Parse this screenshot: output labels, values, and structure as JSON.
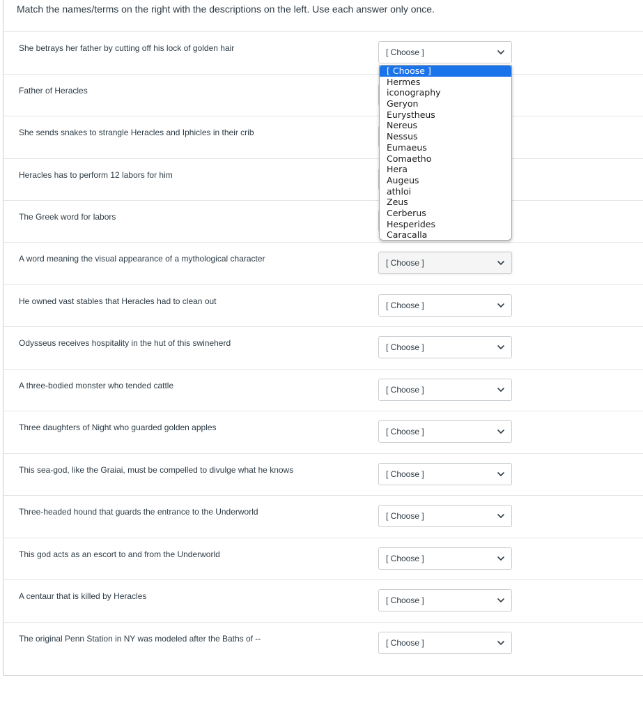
{
  "instructions": "Match the names/terms on the right with the descriptions on the left.  Use each answer only once.",
  "questions": [
    {
      "description": "She betrays her father by cutting off his lock of golden hair",
      "selected": "[ Choose ]"
    },
    {
      "description": "Father of Heracles",
      "selected": "[ Choose ]"
    },
    {
      "description": "She sends snakes to strangle Heracles and Iphicles in their crib",
      "selected": "[ Choose ]"
    },
    {
      "description": "Heracles has to perform 12 labors for him",
      "selected": "[ Choose ]"
    },
    {
      "description": "The Greek word for labors",
      "selected": "[ Choose ]"
    },
    {
      "description": "A word meaning the visual appearance of a mythological character",
      "selected": "[ Choose ]"
    },
    {
      "description": "He owned vast stables that Heracles had to clean out",
      "selected": "[ Choose ]"
    },
    {
      "description": "Odysseus receives hospitality in the hut of this swineherd",
      "selected": "[ Choose ]"
    },
    {
      "description": "A three-bodied monster who tended cattle",
      "selected": "[ Choose ]"
    },
    {
      "description": "Three daughters of Night who guarded golden apples",
      "selected": "[ Choose ]"
    },
    {
      "description": "This sea-god, like the Graiai, must be compelled to divulge what he knows",
      "selected": "[ Choose ]"
    },
    {
      "description": "Three-headed hound that guards the entrance to the Underworld",
      "selected": "[ Choose ]"
    },
    {
      "description": "This god acts as an escort to and from the Underworld",
      "selected": "[ Choose ]"
    },
    {
      "description": "A centaur that is killed by Heracles",
      "selected": "[ Choose ]"
    },
    {
      "description": "The original Penn Station in NY was modeled after the Baths of --",
      "selected": "[ Choose ]"
    }
  ],
  "dropdown_options": [
    "[ Choose ]",
    "Hermes",
    "iconography",
    "Geryon",
    "Eurystheus",
    "Nereus",
    "Nessus",
    "Eumaeus",
    "Comaetho",
    "Hera",
    "Augeus",
    "athloi",
    "Zeus",
    "Cerberus",
    "Hesperides",
    "Caracalla"
  ],
  "colors": {
    "selected_option_bg": "#1a73e8",
    "text": "#2d3b45",
    "border": "#c7cdd1"
  }
}
